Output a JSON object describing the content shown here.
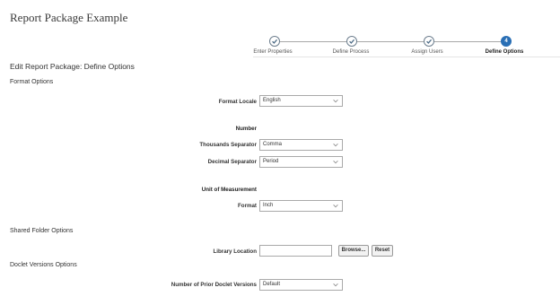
{
  "page": {
    "title": "Report Package Example",
    "subtitle": "Edit Report Package: Define Options"
  },
  "train": {
    "steps": [
      {
        "label": "Enter Properties",
        "state": "complete"
      },
      {
        "label": "Define Process",
        "state": "complete"
      },
      {
        "label": "Assign Users",
        "state": "complete"
      },
      {
        "label": "Define Options",
        "state": "current",
        "number": "4"
      }
    ]
  },
  "format_options": {
    "section_title": "Format Options",
    "format_locale": {
      "label": "Format Locale",
      "value": "English"
    },
    "number": {
      "group_label": "Number",
      "thousands_separator": {
        "label": "Thousands Separator",
        "value": "Comma"
      },
      "decimal_separator": {
        "label": "Decimal Separator",
        "value": "Period"
      }
    },
    "unit_of_measurement": {
      "group_label": "Unit of Measurement",
      "format": {
        "label": "Format",
        "value": "Inch"
      }
    }
  },
  "shared_folder_options": {
    "section_title": "Shared Folder Options",
    "library_location": {
      "label": "Library Location",
      "value": ""
    },
    "browse_label": "Browse...",
    "reset_label": "Reset"
  },
  "doclet_versions_options": {
    "section_title": "Doclet Versions Options",
    "prior_versions": {
      "label": "Number of Prior Doclet Versions",
      "value": "Default"
    }
  },
  "colors": {
    "accent": "#2a6fb5",
    "check": "#4a6a85",
    "border": "#a9a9a9"
  },
  "icons": {
    "complete_step": "check-icon",
    "dropdown": "chevron-down-icon"
  }
}
